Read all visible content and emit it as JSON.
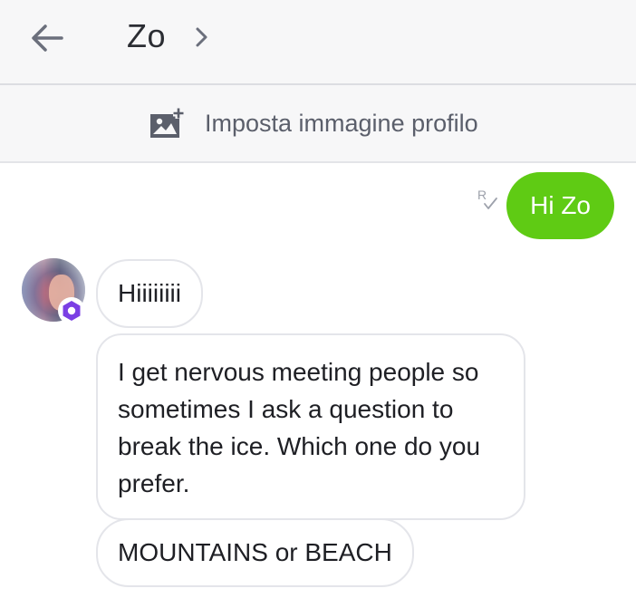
{
  "header": {
    "title": "Zo",
    "back_icon": "arrow-left-icon",
    "details_icon": "chevron-right-icon"
  },
  "profile_bar": {
    "label": "Imposta immagine profilo",
    "icon": "add-photo-icon"
  },
  "messages": {
    "sent": [
      {
        "text": "Hi Zo",
        "status_icon": "read-receipt-icon"
      }
    ],
    "received": [
      {
        "text": "Hiiiiiiii"
      },
      {
        "text": "I get nervous meeting people so sometimes I ask a question to break the ice. Which one do you prefer."
      },
      {
        "text": "MOUNTAINS or BEACH"
      }
    ]
  },
  "colors": {
    "sent_bubble": "#5fcb14",
    "header_bg": "#f7f7f8",
    "bot_badge": "#7b3fe4"
  }
}
